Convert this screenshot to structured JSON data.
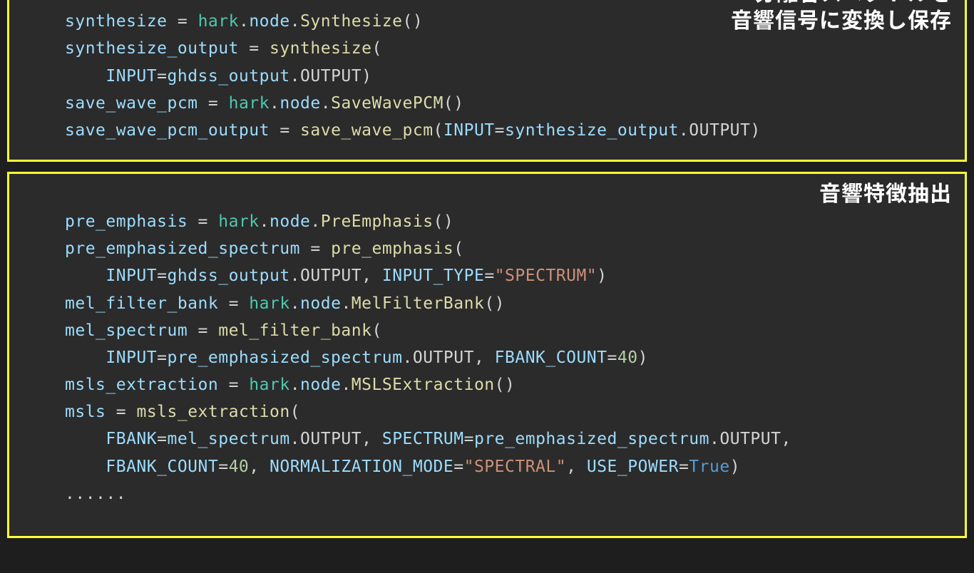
{
  "boxes": [
    {
      "annotation": "分離音スペクトルを\n音響信号に変換し保存",
      "height_style": "min-height:206px; padding-top:10px; padding-bottom:22px;",
      "code_html": "<span class=\"tk-dots\">......</span>\n<span class=\"tk-id\">synthesize</span> <span class=\"tk-op\">=</span> <span class=\"tk-fn\">hark</span><span class=\"tk-pun\">.</span><span class=\"tk-id\">node</span><span class=\"tk-pun\">.</span><span class=\"tk-call\">Synthesize</span><span class=\"tk-pun\">()</span>\n<span class=\"tk-id\">synthesize_output</span> <span class=\"tk-op\">=</span> <span class=\"tk-call\">synthesize</span><span class=\"tk-pun\">(</span>\n    <span class=\"tk-id\">INPUT</span><span class=\"tk-op\">=</span><span class=\"tk-id\">ghdss_output</span><span class=\"tk-pun\">.</span><span class=\"tk-attr\">OUTPUT</span><span class=\"tk-pun\">)</span>\n<span class=\"tk-id\">save_wave_pcm</span> <span class=\"tk-op\">=</span> <span class=\"tk-fn\">hark</span><span class=\"tk-pun\">.</span><span class=\"tk-id\">node</span><span class=\"tk-pun\">.</span><span class=\"tk-call\">SaveWavePCM</span><span class=\"tk-pun\">()</span>\n<span class=\"tk-id\">save_wave_pcm_output</span> <span class=\"tk-op\">=</span> <span class=\"tk-call\">save_wave_pcm</span><span class=\"tk-pun\">(</span><span class=\"tk-id\">INPUT</span><span class=\"tk-op\">=</span><span class=\"tk-id\">synthesize_output</span><span class=\"tk-pun\">.</span><span class=\"tk-attr\">OUTPUT</span><span class=\"tk-pun\">)</span>"
    },
    {
      "annotation": "音響特徴抽出",
      "height_style": "padding-top:48px; padding-bottom:40px; margin-top:14px;",
      "code_html": "<span class=\"tk-id\">pre_emphasis</span> <span class=\"tk-op\">=</span> <span class=\"tk-fn\">hark</span><span class=\"tk-pun\">.</span><span class=\"tk-id\">node</span><span class=\"tk-pun\">.</span><span class=\"tk-call\">PreEmphasis</span><span class=\"tk-pun\">()</span>\n<span class=\"tk-id\">pre_emphasized_spectrum</span> <span class=\"tk-op\">=</span> <span class=\"tk-call\">pre_emphasis</span><span class=\"tk-pun\">(</span>\n    <span class=\"tk-id\">INPUT</span><span class=\"tk-op\">=</span><span class=\"tk-id\">ghdss_output</span><span class=\"tk-pun\">.</span><span class=\"tk-attr\">OUTPUT</span><span class=\"tk-pun\">,</span> <span class=\"tk-id\">INPUT_TYPE</span><span class=\"tk-op\">=</span><span class=\"tk-str\">\"SPECTRUM\"</span><span class=\"tk-pun\">)</span>\n<span class=\"tk-id\">mel_filter_bank</span> <span class=\"tk-op\">=</span> <span class=\"tk-fn\">hark</span><span class=\"tk-pun\">.</span><span class=\"tk-id\">node</span><span class=\"tk-pun\">.</span><span class=\"tk-call\">MelFilterBank</span><span class=\"tk-pun\">()</span>\n<span class=\"tk-id\">mel_spectrum</span> <span class=\"tk-op\">=</span> <span class=\"tk-call\">mel_filter_bank</span><span class=\"tk-pun\">(</span>\n    <span class=\"tk-id\">INPUT</span><span class=\"tk-op\">=</span><span class=\"tk-id\">pre_emphasized_spectrum</span><span class=\"tk-pun\">.</span><span class=\"tk-attr\">OUTPUT</span><span class=\"tk-pun\">,</span> <span class=\"tk-id\">FBANK_COUNT</span><span class=\"tk-op\">=</span><span class=\"tk-num\">40</span><span class=\"tk-pun\">)</span>\n<span class=\"tk-id\">msls_extraction</span> <span class=\"tk-op\">=</span> <span class=\"tk-fn\">hark</span><span class=\"tk-pun\">.</span><span class=\"tk-id\">node</span><span class=\"tk-pun\">.</span><span class=\"tk-call\">MSLSExtraction</span><span class=\"tk-pun\">()</span>\n<span class=\"tk-id\">msls</span> <span class=\"tk-op\">=</span> <span class=\"tk-call\">msls_extraction</span><span class=\"tk-pun\">(</span>\n    <span class=\"tk-id\">FBANK</span><span class=\"tk-op\">=</span><span class=\"tk-id\">mel_spectrum</span><span class=\"tk-pun\">.</span><span class=\"tk-attr\">OUTPUT</span><span class=\"tk-pun\">,</span> <span class=\"tk-id\">SPECTRUM</span><span class=\"tk-op\">=</span><span class=\"tk-id\">pre_emphasized_spectrum</span><span class=\"tk-pun\">.</span><span class=\"tk-attr\">OUTPUT</span><span class=\"tk-pun\">,</span>\n    <span class=\"tk-id\">FBANK_COUNT</span><span class=\"tk-op\">=</span><span class=\"tk-num\">40</span><span class=\"tk-pun\">,</span> <span class=\"tk-id\">NORMALIZATION_MODE</span><span class=\"tk-op\">=</span><span class=\"tk-str\">\"SPECTRAL\"</span><span class=\"tk-pun\">,</span> <span class=\"tk-id\">USE_POWER</span><span class=\"tk-op\">=</span><span class=\"tk-kw\">True</span><span class=\"tk-pun\">)</span>\n<span class=\"tk-dots\">......</span>"
    }
  ]
}
